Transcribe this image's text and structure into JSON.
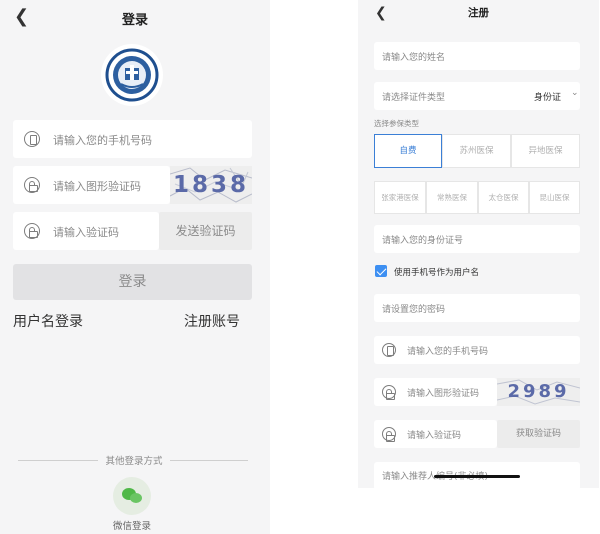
{
  "login": {
    "title": "登录",
    "back_icon": "chevron-left-icon",
    "logo_icon": "emblem-logo",
    "phone_placeholder": "请输入您的手机号码",
    "captcha_placeholder": "请输入图形验证码",
    "captcha_code": "1838",
    "sms_placeholder": "请输入验证码",
    "send_code_label": "发送验证码",
    "login_button": "登录",
    "username_login": "用户名登录",
    "register_account": "注册账号",
    "other_login_label": "其他登录方式",
    "wechat_label": "微信登录"
  },
  "register": {
    "title": "注册",
    "back_icon": "chevron-left-icon",
    "name_placeholder": "请输入您的姓名",
    "id_type_placeholder": "请选择证件类型",
    "id_type_value": "身份证",
    "insurance_type_label": "选择参保类型",
    "insurance_types": [
      "自费",
      "苏州医保",
      "异地医保",
      "张家港医保",
      "常熟医保",
      "太仓医保",
      "昆山医保"
    ],
    "insurance_selected": "自费",
    "id_number_placeholder": "请输入您的身份证号",
    "use_phone_as_username": "使用手机号作为用户名",
    "use_phone_checked": true,
    "password_placeholder": "请设置您的密码",
    "phone_placeholder": "请输入您的手机号码",
    "captcha_placeholder": "请输入图形验证码",
    "captcha_code": "2989",
    "sms_placeholder": "请输入验证码",
    "get_code_label": "获取验证码",
    "referrer_placeholder": "请输入推荐人编号(非必填)"
  },
  "colors": {
    "accent": "#3b7fd6",
    "checkbox": "#3d8ff2",
    "wechat": "#4fb847",
    "background": "#f5f5f6"
  }
}
